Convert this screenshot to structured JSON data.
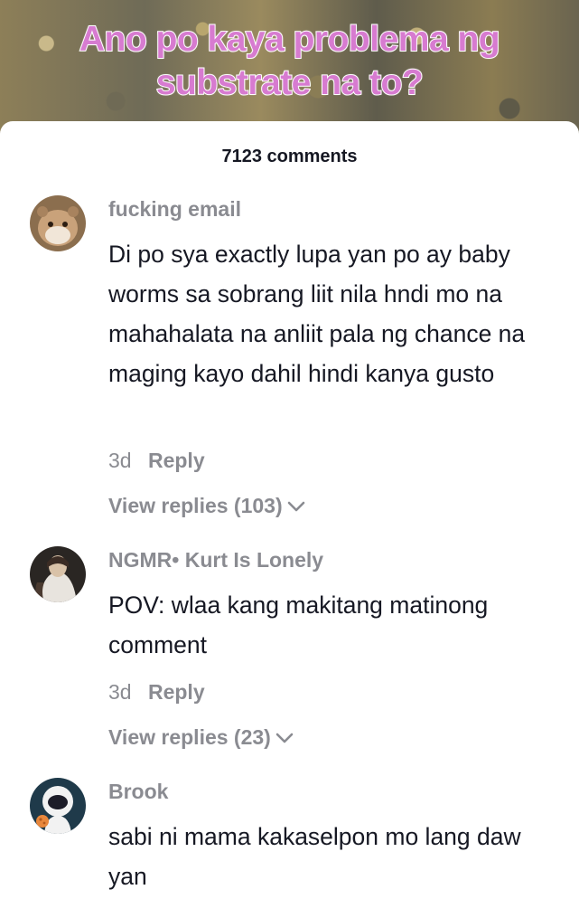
{
  "video": {
    "caption_line1": "Ano po kaya problema ng",
    "caption_line2": "substrate na to?"
  },
  "comments_header": {
    "count_label": "7123 comments"
  },
  "comments": [
    {
      "author": "fucking email",
      "text": "Di po sya exactly lupa yan po ay baby worms sa sobrang liit nila hndi mo na mahahalata na anliit pala ng chance na maging kayo dahil hindi kanya gusto",
      "time": "3d",
      "reply_label": "Reply",
      "view_replies": "View replies (103)"
    },
    {
      "author": "NGMR• Kurt Is Lonely",
      "text": "POV: wlaa kang makitang matinong comment",
      "time": "3d",
      "reply_label": "Reply",
      "view_replies": "View replies (23)"
    },
    {
      "author": "Brook",
      "text": "sabi ni mama kakaselpon mo lang daw yan"
    }
  ],
  "colors": {
    "caption_fill": "#d77bd0",
    "caption_stroke": "#ffffff",
    "primary_text": "#161823",
    "secondary_text": "#8a8b91"
  },
  "icons": {
    "expand": "chevron-down-icon"
  }
}
